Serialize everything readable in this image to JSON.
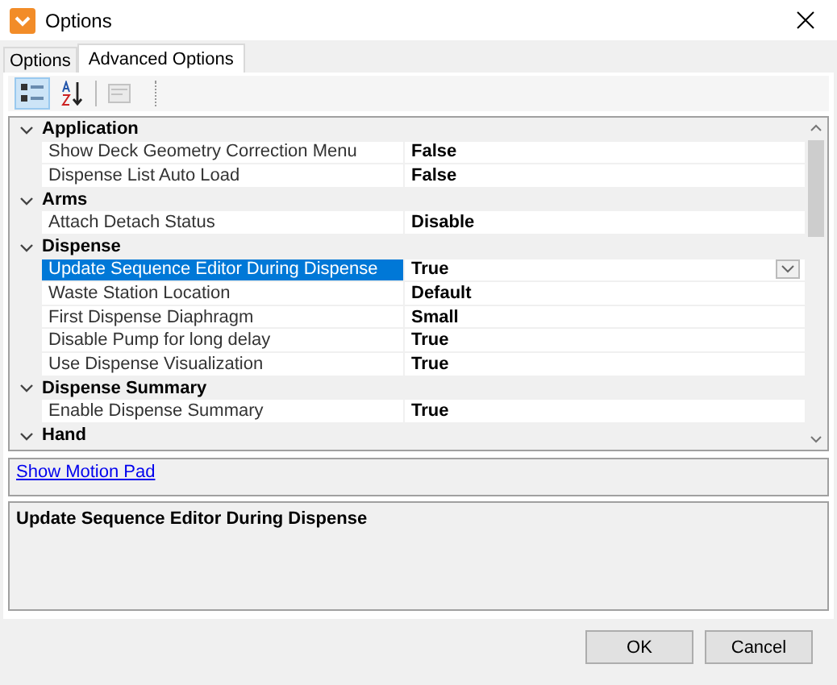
{
  "window": {
    "title": "Options"
  },
  "tabs": [
    {
      "label": "Options",
      "selected": false
    },
    {
      "label": "Advanced Options",
      "selected": true
    }
  ],
  "toolbar": [
    {
      "kind": "categorized",
      "selected": true,
      "disabled": false
    },
    {
      "kind": "alphabetical",
      "selected": false,
      "disabled": false
    },
    {
      "kind": "property-pages",
      "selected": false,
      "disabled": true
    }
  ],
  "grid": {
    "categories": [
      {
        "name": "Application",
        "expanded": true,
        "properties": [
          {
            "name": "Show Deck Geometry Correction Menu",
            "value": "False",
            "selected": false
          },
          {
            "name": "Dispense List Auto Load",
            "value": "False",
            "selected": false
          }
        ]
      },
      {
        "name": "Arms",
        "expanded": true,
        "properties": [
          {
            "name": "Attach Detach Status",
            "value": "Disable",
            "selected": false
          }
        ]
      },
      {
        "name": "Dispense",
        "expanded": true,
        "properties": [
          {
            "name": "Update Sequence Editor During Dispense",
            "value": "True",
            "selected": true
          },
          {
            "name": "Waste Station Location",
            "value": "Default",
            "selected": false
          },
          {
            "name": "First Dispense Diaphragm",
            "value": "Small",
            "selected": false
          },
          {
            "name": "Disable Pump for long delay",
            "value": "True",
            "selected": false
          },
          {
            "name": "Use Dispense Visualization",
            "value": "True",
            "selected": false
          }
        ]
      },
      {
        "name": "Dispense Summary",
        "expanded": true,
        "properties": [
          {
            "name": "Enable Dispense Summary",
            "value": "True",
            "selected": false
          }
        ]
      },
      {
        "name": "Hand",
        "expanded": true
      }
    ]
  },
  "link": "Show Motion Pad",
  "description": {
    "title": "Update Sequence Editor During Dispense"
  },
  "buttons": [
    "OK",
    "Cancel"
  ]
}
